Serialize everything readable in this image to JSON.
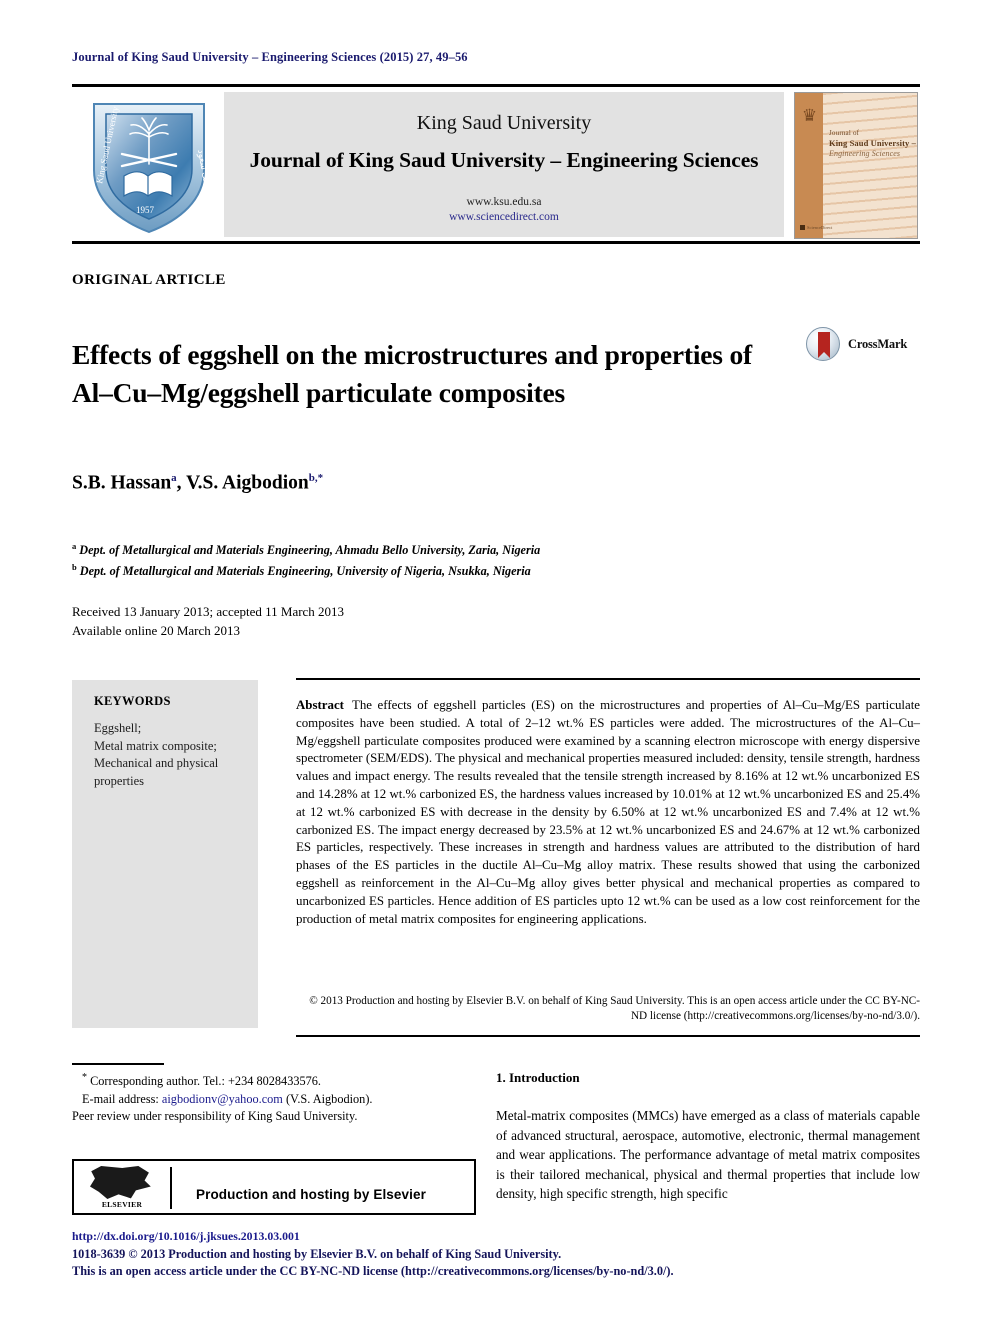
{
  "running_head": "Journal of King Saud University – Engineering Sciences (2015) 27, 49–56",
  "masthead": {
    "university": "King Saud University",
    "journal_title": "Journal of King Saud University – Engineering Sciences",
    "url_primary": "www.ksu.edu.sa",
    "url_secondary": "www.sciencedirect.com",
    "logo_name": "King Saud University",
    "logo_year": "1957",
    "cover": {
      "line1": "Journal of",
      "line2": "King Saud University –",
      "line3": "Engineering Sciences",
      "footer": "ScienceDirect"
    }
  },
  "article": {
    "type": "ORIGINAL ARTICLE",
    "title": "Effects of eggshell on the microstructures and properties of Al–Cu–Mg/eggshell particulate composites",
    "crossmark_label": "CrossMark",
    "authors": "S.B. Hassan , V.S. Aigbodion",
    "author1": "S.B. Hassan",
    "author1_sup": "a",
    "author2": "V.S. Aigbodion",
    "author2_sup": "b,*",
    "affiliations": [
      {
        "marker": "a",
        "text": "Dept. of Metallurgical and Materials Engineering, Ahmadu Bello University, Zaria, Nigeria"
      },
      {
        "marker": "b",
        "text": "Dept. of Metallurgical and Materials Engineering, University of Nigeria, Nsukka, Nigeria"
      }
    ],
    "received": "Received 13 January 2013; accepted 11 March 2013",
    "available_online": "Available online 20 March 2013"
  },
  "keywords": {
    "heading": "KEYWORDS",
    "items": "Eggshell;\nMetal matrix composite;\nMechanical and physical properties"
  },
  "abstract": {
    "label": "Abstract",
    "body": "The effects of eggshell particles (ES) on the microstructures and properties of Al–Cu–Mg/ES particulate composites have been studied. A total of 2–12 wt.% ES particles were added. The microstructures of the Al–Cu–Mg/eggshell particulate composites produced were examined by a scanning electron microscope with energy dispersive spectrometer (SEM/EDS). The physical and mechanical properties measured included: density, tensile strength, hardness values and impact energy. The results revealed that the tensile strength increased by 8.16% at 12 wt.% uncarbonized ES and 14.28% at 12 wt.% carbonized ES, the hardness values increased by 10.01% at 12 wt.% uncarbonized ES and 25.4% at 12 wt.% carbonized ES with decrease in the density by 6.50% at 12 wt.% uncarbonized ES and 7.4% at 12 wt.% carbonized ES. The impact energy decreased by 23.5% at 12 wt.% uncarbonized ES and 24.67% at 12 wt.% carbonized ES particles, respectively. These increases in strength and hardness values are attributed to the distribution of hard phases of the ES particles in the ductile Al–Cu–Mg alloy matrix. These results showed that using the carbonized eggshell as reinforcement in the Al–Cu–Mg alloy gives better physical and mechanical properties as compared to uncarbonized ES particles. Hence addition of ES particles upto 12 wt.% can be used as a low cost reinforcement for the production of metal matrix composites for engineering applications.",
    "copyright": "© 2013 Production and hosting by Elsevier B.V. on behalf of King Saud University. This is an open access article under the CC BY-NC-ND license (http://creativecommons.org/licenses/by-no-nd/3.0/)."
  },
  "footnotes": {
    "corresponding_marker": "*",
    "corresponding": "Corresponding author. Tel.: +234 8028433576.",
    "email_label": "E-mail address:",
    "email": "aigbodionv@yahoo.com",
    "email_suffix": "(V.S. Aigbodion).",
    "peer_review": "Peer review under responsibility of King Saud University."
  },
  "elsevier_box": {
    "logo_word": "ELSEVIER",
    "text": "Production and hosting by Elsevier"
  },
  "bottom": {
    "doi": "http://dx.doi.org/10.1016/j.jksues.2013.03.001",
    "line1": "1018-3639 © 2013 Production and hosting by Elsevier B.V. on behalf of King Saud University.",
    "line2": "This is an open access article under the CC BY-NC-ND license (http://creativecommons.org/licenses/by-no-nd/3.0/)."
  },
  "introduction": {
    "heading": "1. Introduction",
    "body": "Metal-matrix composites (MMCs) have emerged as a class of materials capable of advanced structural, aerospace, automotive, electronic, thermal management and wear applications. The performance advantage of metal matrix composites is their tailored mechanical, physical and thermal properties that include low density, high specific strength, high specific"
  },
  "colors": {
    "link": "#1a1a8c",
    "running_head": "#1a1a6e",
    "panel_gray": "#e2e2e2",
    "crossmark_red": "#b5241f",
    "cover_orange": "#c88a52"
  }
}
